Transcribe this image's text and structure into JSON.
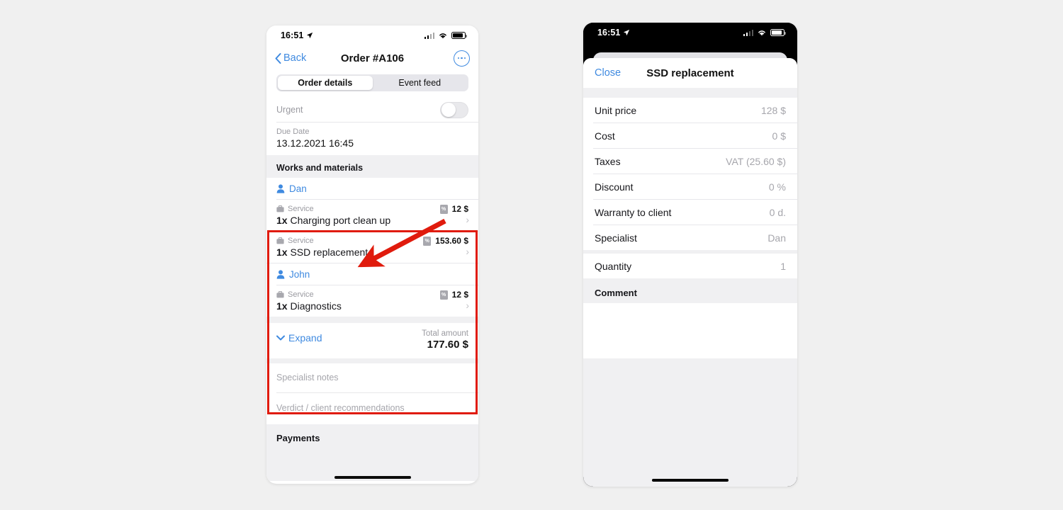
{
  "colors": {
    "page_bg": "#f0f0f0",
    "accent_blue": "#3f8ae0",
    "annotation_red": "#e01b0d",
    "muted_gray": "#9a9aa0"
  },
  "left_phone": {
    "status_bar": {
      "time": "16:51",
      "location_icon": "location-arrow-icon",
      "signal_icon": "cellular-signal-icon",
      "wifi_icon": "wifi-icon",
      "battery_icon": "battery-icon"
    },
    "nav": {
      "back_label": "Back",
      "back_icon": "chevron-left-icon",
      "title": "Order #A106",
      "more_icon": "more-options-icon"
    },
    "tabs": [
      {
        "label": "Order details",
        "active": true
      },
      {
        "label": "Event feed",
        "active": false
      }
    ],
    "urgent": {
      "label": "Urgent",
      "toggle_state": "off"
    },
    "due_date": {
      "label": "Due Date",
      "value": "13.12.2021 16:45"
    },
    "works_section": {
      "title": "Works and materials",
      "groups": [
        {
          "person": "Dan",
          "person_icon": "person-icon",
          "items": [
            {
              "kind": "Service",
              "kind_icon": "briefcase-icon",
              "quantity": "1x",
              "name": "Charging port clean up",
              "price": "12 $",
              "tax_badge": "tax-badge-icon",
              "chevron": "chevron-right-icon"
            },
            {
              "kind": "Service",
              "kind_icon": "briefcase-icon",
              "quantity": "1x",
              "name": "SSD replacement",
              "price": "153.60 $",
              "tax_badge": "tax-badge-icon",
              "chevron": "chevron-right-icon"
            }
          ]
        },
        {
          "person": "John",
          "person_icon": "person-icon",
          "items": [
            {
              "kind": "Service",
              "kind_icon": "briefcase-icon",
              "quantity": "1x",
              "name": "Diagnostics",
              "price": "12 $",
              "tax_badge": "tax-badge-icon",
              "chevron": "chevron-right-icon"
            }
          ]
        }
      ]
    },
    "totals": {
      "expand_label": "Expand",
      "expand_icon": "chevron-down-icon",
      "total_label": "Total amount",
      "total_value": "177.60 $"
    },
    "notes": {
      "specialist_notes_placeholder": "Specialist notes",
      "verdict_placeholder": "Verdict / client recommendations"
    },
    "payments": {
      "title": "Payments"
    }
  },
  "right_phone": {
    "status_bar": {
      "time": "16:51",
      "location_icon": "location-arrow-icon",
      "signal_icon": "cellular-signal-icon",
      "wifi_icon": "wifi-icon",
      "battery_icon": "battery-icon"
    },
    "modal": {
      "close_label": "Close",
      "title": "SSD replacement",
      "rows": [
        {
          "key": "Unit price",
          "value": "128 $"
        },
        {
          "key": "Cost",
          "value": "0 $"
        },
        {
          "key": "Taxes",
          "value": "VAT (25.60 $)"
        },
        {
          "key": "Discount",
          "value": "0 %"
        },
        {
          "key": "Warranty to client",
          "value": "0 d."
        },
        {
          "key": "Specialist",
          "value": "Dan"
        }
      ],
      "quantity_row": {
        "key": "Quantity",
        "value": "1"
      },
      "comment": {
        "title": "Comment",
        "value": ""
      }
    }
  },
  "annotation": {
    "arrow_icon": "red-arrow-pointer",
    "highlight_box": "works-and-materials-highlight"
  }
}
